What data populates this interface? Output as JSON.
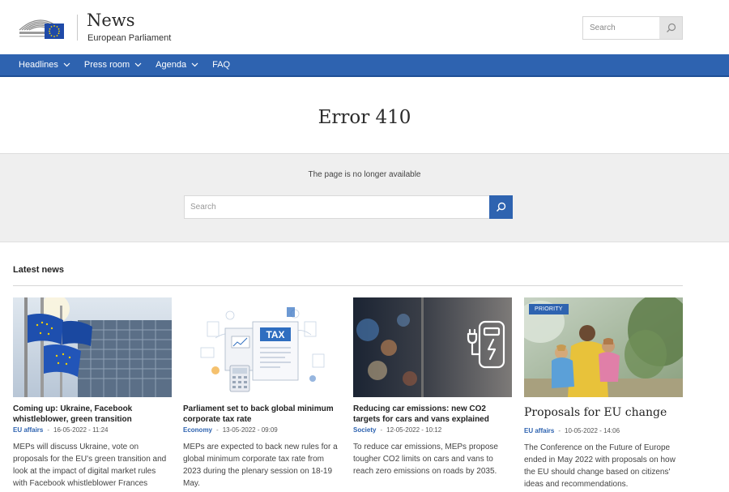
{
  "header": {
    "title": "News",
    "subtitle": "European Parliament",
    "search_placeholder": "Search"
  },
  "nav": {
    "items": [
      {
        "label": "Headlines",
        "has_dropdown": true
      },
      {
        "label": "Press room",
        "has_dropdown": true
      },
      {
        "label": "Agenda",
        "has_dropdown": true
      },
      {
        "label": "FAQ",
        "has_dropdown": false
      }
    ]
  },
  "error": {
    "title": "Error 410",
    "message": "The page is no longer available",
    "search_placeholder": "Search"
  },
  "latest": {
    "heading": "Latest news",
    "cards": [
      {
        "title": "Coming up: Ukraine, Facebook whistleblower, green transition",
        "category": "EU affairs",
        "date": "16-05-2022 - 11:24",
        "description": "MEPs will discuss Ukraine, vote on proposals for the EU's green transition and look at the impact of digital market rules with Facebook whistleblower Frances",
        "image": "eu-flags-parliament-photo"
      },
      {
        "title": "Parliament set to back global minimum corporate tax rate",
        "category": "Economy",
        "date": "13-05-2022 - 09:09",
        "description": "MEPs are expected to back new rules for a global minimum corporate tax rate from 2023 during the plenary session on 18-19 May.",
        "image": "tax-illustration"
      },
      {
        "title": "Reducing car emissions: new CO2 targets for cars and vans explained",
        "category": "Society",
        "date": "12-05-2022 - 10:12",
        "description": "To reduce car emissions, MEPs propose tougher CO2 limits on cars and vans to reach zero emissions on roads by 2035.",
        "image": "ev-charging-photo"
      },
      {
        "title": "Proposals for EU change",
        "category": "EU affairs",
        "date": "10-05-2022 - 14:06",
        "badge": "PRIORITY",
        "description": "The Conference on the Future of Europe ended in May 2022 with proposals on how the EU should change based on citizens' ideas and recommendations.",
        "image": "family-photo"
      }
    ]
  },
  "colors": {
    "brand_blue": "#2e63b0",
    "band_gray": "#efefef"
  }
}
